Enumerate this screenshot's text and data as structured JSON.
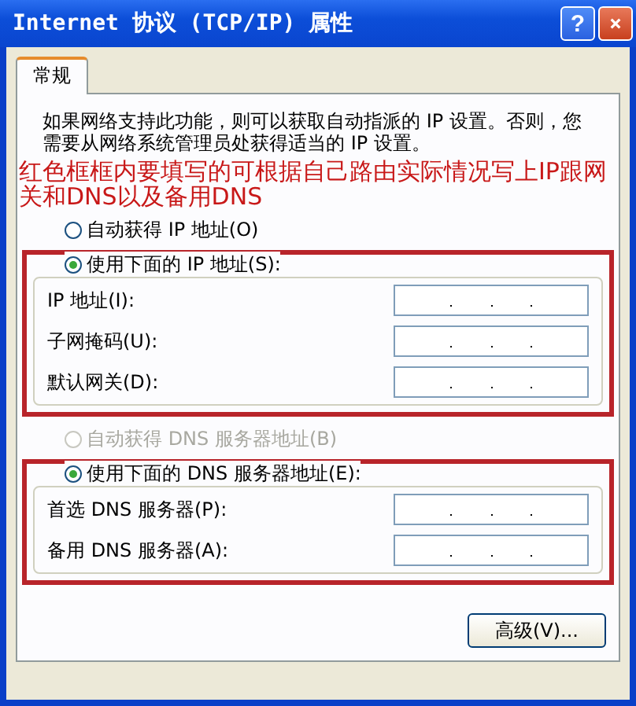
{
  "window": {
    "title": "Internet 协议 (TCP/IP) 属性",
    "help_button": "?"
  },
  "tabs": [
    {
      "label": "常规",
      "selected": true
    }
  ],
  "description": "如果网络支持此功能，则可以获取自动指派的 IP 设置。否则，您需要从网络系统管理员处获得适当的 IP 设置。",
  "annotation": "红色框框内要填写的可根据自己路由实际情况写上IP跟网关和DNS以及备用DNS",
  "ip_section": {
    "auto_radio": {
      "label": "自动获得 IP 地址(O)",
      "selected": false,
      "disabled": false
    },
    "manual_radio": {
      "label": "使用下面的 IP 地址(S):",
      "selected": true,
      "disabled": false
    },
    "fields": [
      {
        "label": "IP 地址(I):"
      },
      {
        "label": "子网掩码(U):"
      },
      {
        "label": "默认网关(D):"
      }
    ]
  },
  "dns_section": {
    "auto_radio": {
      "label": "自动获得 DNS 服务器地址(B)",
      "selected": false,
      "disabled": true
    },
    "manual_radio": {
      "label": "使用下面的 DNS 服务器地址(E):",
      "selected": true,
      "disabled": false
    },
    "fields": [
      {
        "label": "首选 DNS 服务器(P):"
      },
      {
        "label": "备用 DNS 服务器(A):"
      }
    ]
  },
  "advanced_button": "高级(V)..."
}
